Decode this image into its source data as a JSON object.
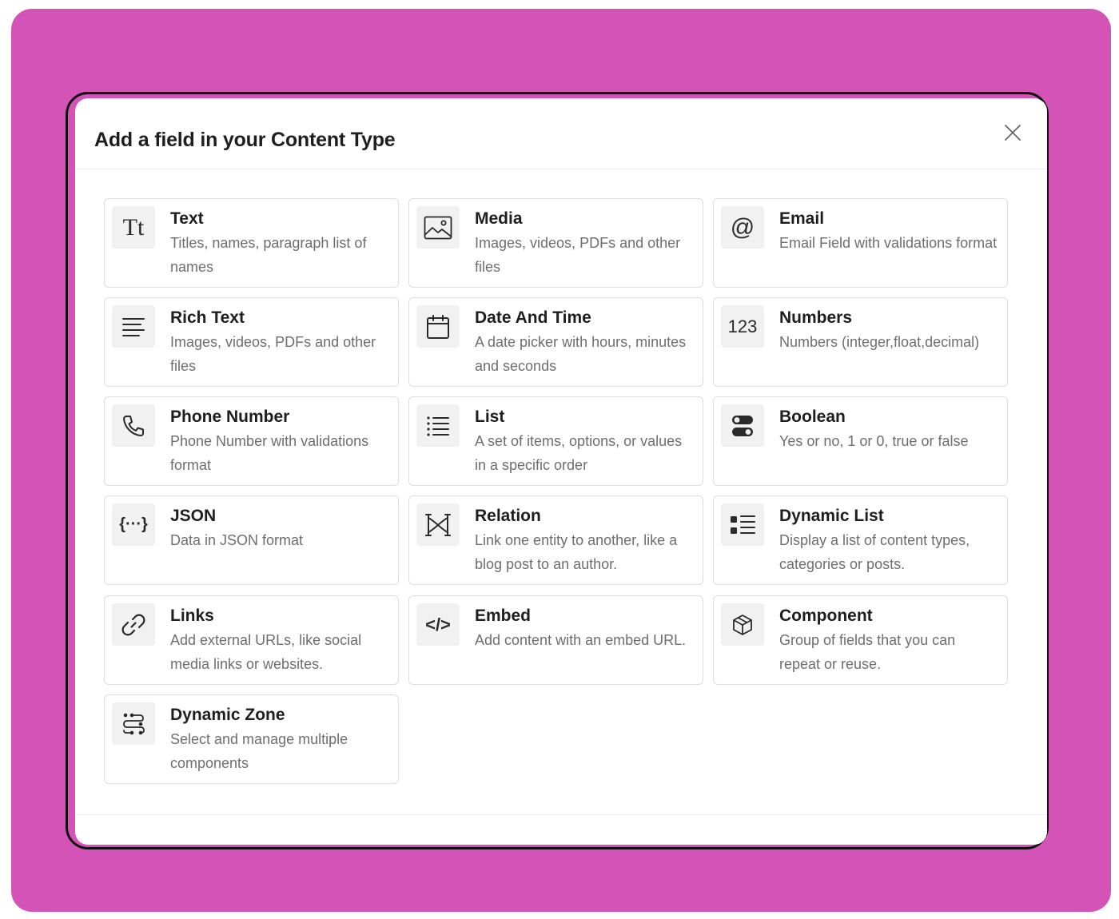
{
  "modal": {
    "title": "Add a field in your Content Type"
  },
  "field_types": [
    {
      "name": "Text",
      "description": "Titles, names, paragraph list of names",
      "icon": "text-type-icon",
      "icon_text": "Tt"
    },
    {
      "name": "Media",
      "description": "Images, videos, PDFs and other files",
      "icon": "image-icon"
    },
    {
      "name": "Email",
      "description": "Email Field with validations format",
      "icon": "at-sign-icon",
      "icon_text": "@"
    },
    {
      "name": "Rich Text",
      "description": "Images, videos, PDFs and other files",
      "icon": "align-left-icon"
    },
    {
      "name": "Date And Time",
      "description": "A date picker with hours, minutes and seconds",
      "icon": "calendar-icon"
    },
    {
      "name": "Numbers",
      "description": "Numbers (integer,float,decimal)",
      "icon": "numbers-icon",
      "icon_text": "123"
    },
    {
      "name": "Phone Number",
      "description": "Phone Number with validations format",
      "icon": "phone-icon"
    },
    {
      "name": "List",
      "description": "A set of items, options, or values in a specific order",
      "icon": "list-icon"
    },
    {
      "name": "Boolean",
      "description": "Yes or no, 1 or 0, true or false",
      "icon": "toggle-icon"
    },
    {
      "name": "JSON",
      "description": "Data in JSON format",
      "icon": "json-icon",
      "icon_text": "{···}"
    },
    {
      "name": "Relation",
      "description": "Link one entity to another, like a blog post to an author.",
      "icon": "relation-icon"
    },
    {
      "name": "Dynamic List",
      "description": "Display a list of content types, categories or posts.",
      "icon": "dynamic-list-icon"
    },
    {
      "name": "Links",
      "description": "Add external URLs, like social media links or websites.",
      "icon": "link-icon"
    },
    {
      "name": "Embed",
      "description": "Add content with an embed URL.",
      "icon": "code-icon",
      "icon_text": "</>"
    },
    {
      "name": "Component",
      "description": "Group of fields that you can repeat or reuse.",
      "icon": "cube-icon"
    },
    {
      "name": "Dynamic Zone",
      "description": "Select and manage multiple components",
      "icon": "dynamic-zone-icon"
    }
  ],
  "colors": {
    "backdrop": "#d354b6",
    "card_border": "#dddddd",
    "icon_bg": "#f1f1f1",
    "title_text": "#1e1e1e",
    "desc_text": "#6e6e6e"
  }
}
